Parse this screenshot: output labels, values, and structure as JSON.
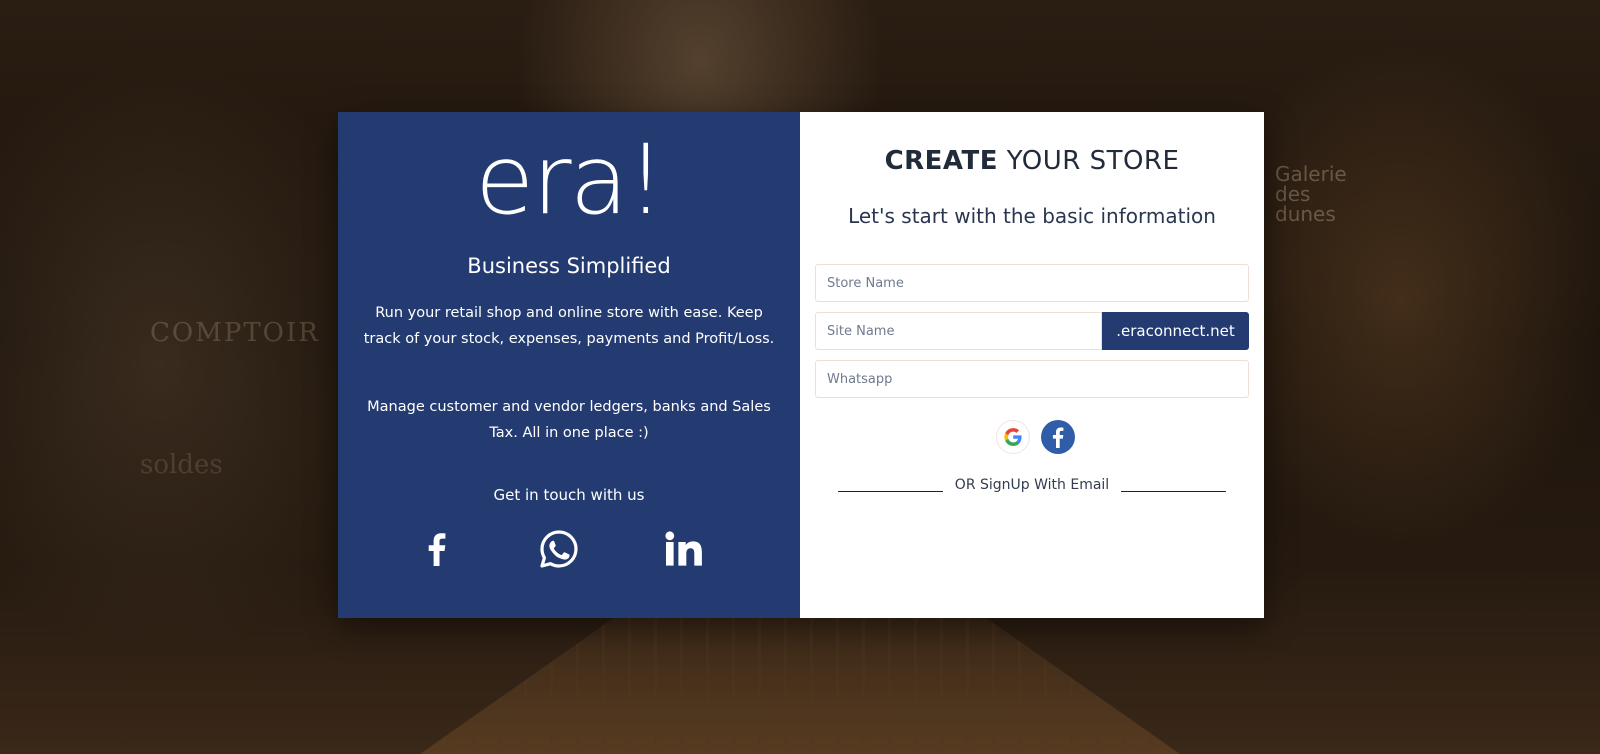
{
  "brand": {
    "logo_text": "era!",
    "tagline": "Business Simplified",
    "description_1": "Run your retail shop and online store with ease. Keep track of your stock, expenses, payments and Profit/Loss.",
    "description_2": "Manage customer and vendor ledgers, banks and Sales Tax. All in one place :)",
    "contact_heading": "Get in touch with us",
    "socials": [
      {
        "icon": "facebook-icon"
      },
      {
        "icon": "whatsapp-icon"
      },
      {
        "icon": "linkedin-icon"
      }
    ],
    "panel_color": "#243b72"
  },
  "background": {
    "sign_galerie": "Galerie des dunes",
    "sign_comptoir": "COMPTOIR",
    "sign_soldes": "soldes"
  },
  "form": {
    "title_bold": "CREATE",
    "title_light": "YOUR STORE",
    "subtitle": "Let's start with the basic information",
    "store_name_placeholder": "Store Name",
    "site_name_placeholder": "Site Name",
    "site_suffix": ".eraconnect.net",
    "whatsapp_placeholder": "Whatsapp",
    "oauth_icons": [
      "google-icon",
      "facebook-icon"
    ],
    "divider_text": "OR SignUp With Email"
  }
}
